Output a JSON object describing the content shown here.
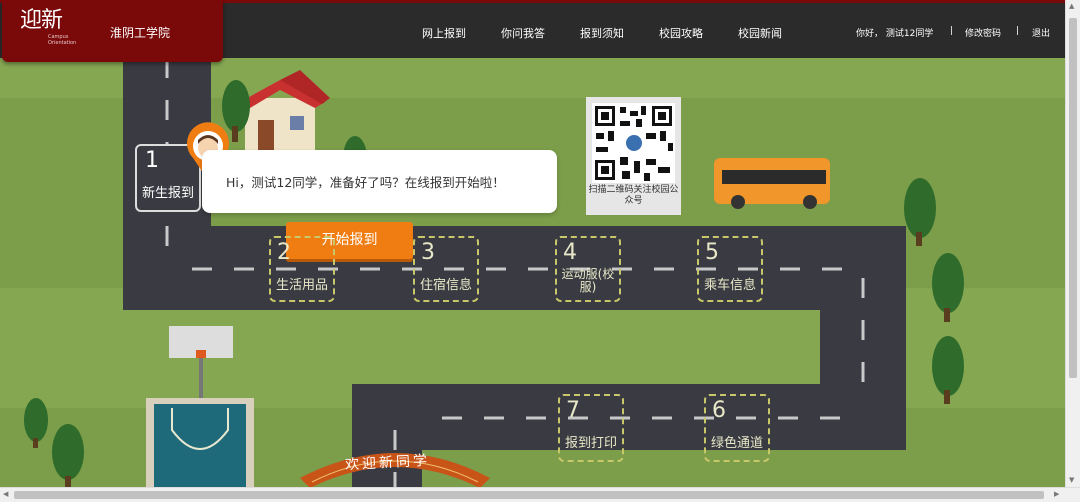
{
  "header": {
    "logo_text": "迎新",
    "logo_sub": "Campus Orientation",
    "school_name": "淮阴工学院",
    "nav": [
      "网上报到",
      "你问我答",
      "报到须知",
      "校园攻略",
      "校园新闻"
    ],
    "greeting": "你好，  测试12同学",
    "change_password": "修改密码",
    "logout": "退出",
    "separator": "|"
  },
  "steps": [
    {
      "num": "1",
      "label": "新生报到"
    },
    {
      "num": "2",
      "label": "生活用品"
    },
    {
      "num": "3",
      "label": "住宿信息"
    },
    {
      "num": "4",
      "label": "运动服(校服)"
    },
    {
      "num": "5",
      "label": "乘车信息"
    },
    {
      "num": "6",
      "label": "绿色通道"
    },
    {
      "num": "7",
      "label": "报到打印"
    }
  ],
  "bubble_text": "Hi，测试12同学，准备好了吗？在线报到开始啦！",
  "start_button": "开始报到",
  "qr_caption": "扫描二维码关注校园公众号",
  "welcome_banner": "欢迎新同学",
  "colors": {
    "header_bg": "#2b2b2b",
    "logo_bg": "#7a0a0a",
    "grass": "#86a752",
    "road": "#3a3b42",
    "accent": "#f07d12"
  }
}
